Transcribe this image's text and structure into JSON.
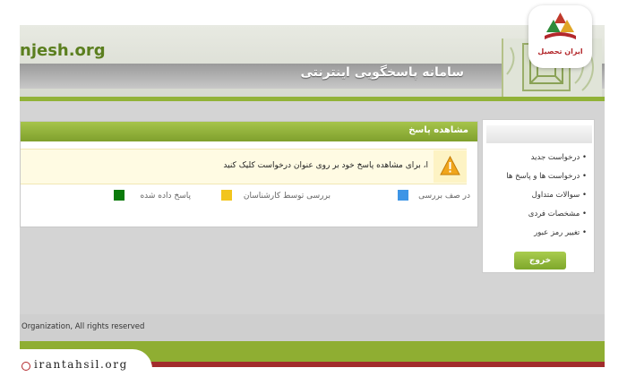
{
  "header": {
    "logo_text": "njesh.org",
    "site_title": "سامانه پاسخگویی اینترنتی"
  },
  "panel": {
    "title": "مشاهده پاسخ",
    "alert_text": "ا، برای مشاهده پاسخ خود بر روی عنوان درخواست کلیک کنید",
    "legend": [
      {
        "label": "در صف بررسی",
        "color": "#3d95e6"
      },
      {
        "label": "بررسی توسط کارشناسان",
        "color": "#f2c51d"
      },
      {
        "label": "پاسخ داده شده",
        "color": "#0a7a0a"
      }
    ]
  },
  "sidebar": {
    "items": [
      {
        "label": "• درخواست جدید"
      },
      {
        "label": "• درخواست ها و پاسخ ها"
      },
      {
        "label": "• سوالات متداول"
      },
      {
        "label": "• مشخصات فردی"
      },
      {
        "label": "• تغییر رمز عبور"
      }
    ],
    "exit_label": "خروج"
  },
  "footer": {
    "copyright": "Organization, All rights reserved"
  },
  "watermark": {
    "badge_text": "ایران تحصیل",
    "site_url": "irantahsil.org"
  },
  "colors": {
    "accent_green": "#8fae32",
    "footer_red": "#a22c2c",
    "alert_bg": "#fffbe3"
  },
  "icons": [
    "warning-icon",
    "emblem-logo",
    "globe-icon"
  ]
}
